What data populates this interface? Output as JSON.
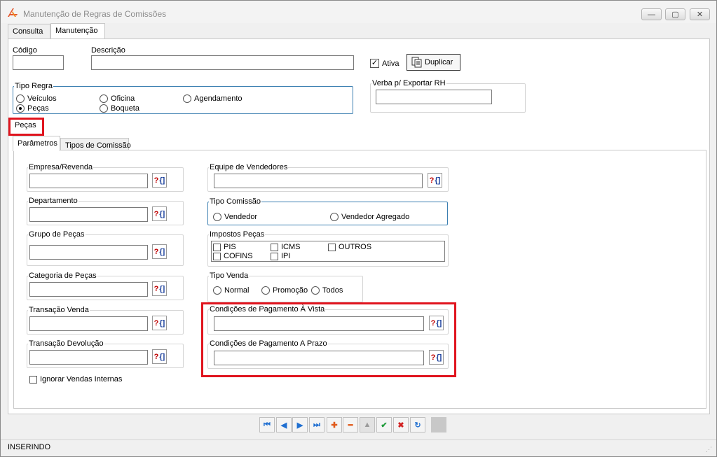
{
  "window": {
    "title": "Manutenção de Regras de Comissões",
    "minimize": "—",
    "maximize": "▢",
    "close": "✕"
  },
  "main_tabs": [
    {
      "label": "Consulta"
    },
    {
      "label": "Manutenção"
    }
  ],
  "header": {
    "codigo_label": "Código",
    "codigo_value": "",
    "descricao_label": "Descrição",
    "descricao_value": "",
    "ativa_label": "Ativa",
    "duplicar_label": "Duplicar"
  },
  "tipo_regra": {
    "title": "Tipo Regra",
    "options": [
      "Veículos",
      "Oficina",
      "Agendamento",
      "Peças",
      "Boqueta"
    ],
    "selected": "Peças"
  },
  "verba": {
    "title": "Verba p/ Exportar RH",
    "value": ""
  },
  "section_tab": "Peças",
  "inner_tabs": [
    {
      "label": "Parâmetros"
    },
    {
      "label": "Tipos de Comissão"
    }
  ],
  "left_fields": [
    {
      "label": "Empresa/Revenda",
      "value": ""
    },
    {
      "label": "Departamento",
      "value": ""
    },
    {
      "label": "Grupo de Peças",
      "value": ""
    },
    {
      "label": "Categoria de Peças",
      "value": ""
    },
    {
      "label": "Transação Venda",
      "value": ""
    },
    {
      "label": "Transação Devolução",
      "value": ""
    }
  ],
  "ignorar_label": "Ignorar Vendas Internas",
  "equipe": {
    "label": "Equipe de Vendedores",
    "value": ""
  },
  "tipo_comissao": {
    "title": "Tipo Comissão",
    "options": [
      "Vendedor",
      "Vendedor Agregado"
    ]
  },
  "impostos": {
    "title": "Impostos Peças",
    "items": [
      "PIS",
      "ICMS",
      "OUTROS",
      "COFINS",
      "IPI"
    ]
  },
  "tipo_venda": {
    "title": "Tipo Venda",
    "options": [
      "Normal",
      "Promoção",
      "Todos"
    ]
  },
  "cond_vista": {
    "label": "Condições de Pagamento À Vista",
    "value": ""
  },
  "cond_prazo": {
    "label": "Condições de Pagamento A Prazo",
    "value": ""
  },
  "lookup_icon": {
    "q": "?",
    "b": "{]"
  },
  "nav_buttons": [
    "⏮",
    "◀",
    "▶",
    "⏭",
    "✚",
    "━",
    "▲",
    "✔",
    "✖",
    "↻"
  ],
  "status": "INSERINDO",
  "colors": {
    "highlight": "#e0141e",
    "group_blue": "#3c7fb1",
    "nav_blue": "#1f6fd1"
  }
}
